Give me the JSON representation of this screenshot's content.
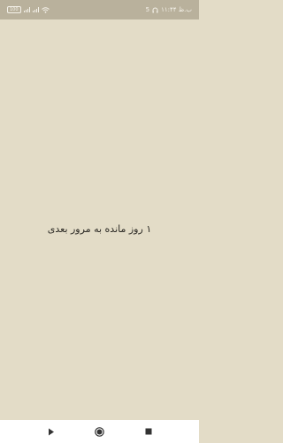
{
  "status_bar": {
    "battery": "100",
    "time": "۱۱:۴۴ ب.ظ",
    "sim_indicator": "5"
  },
  "main": {
    "message": "۱ روز مانده به مرور بعدی"
  },
  "nav": {
    "icons": [
      "back-triangle",
      "home-circle",
      "recents-square"
    ]
  },
  "colors": {
    "background": "#e3dcc7",
    "status_bar": "#b9b19c",
    "nav_bar": "#ffffff",
    "text": "#2a2823"
  }
}
